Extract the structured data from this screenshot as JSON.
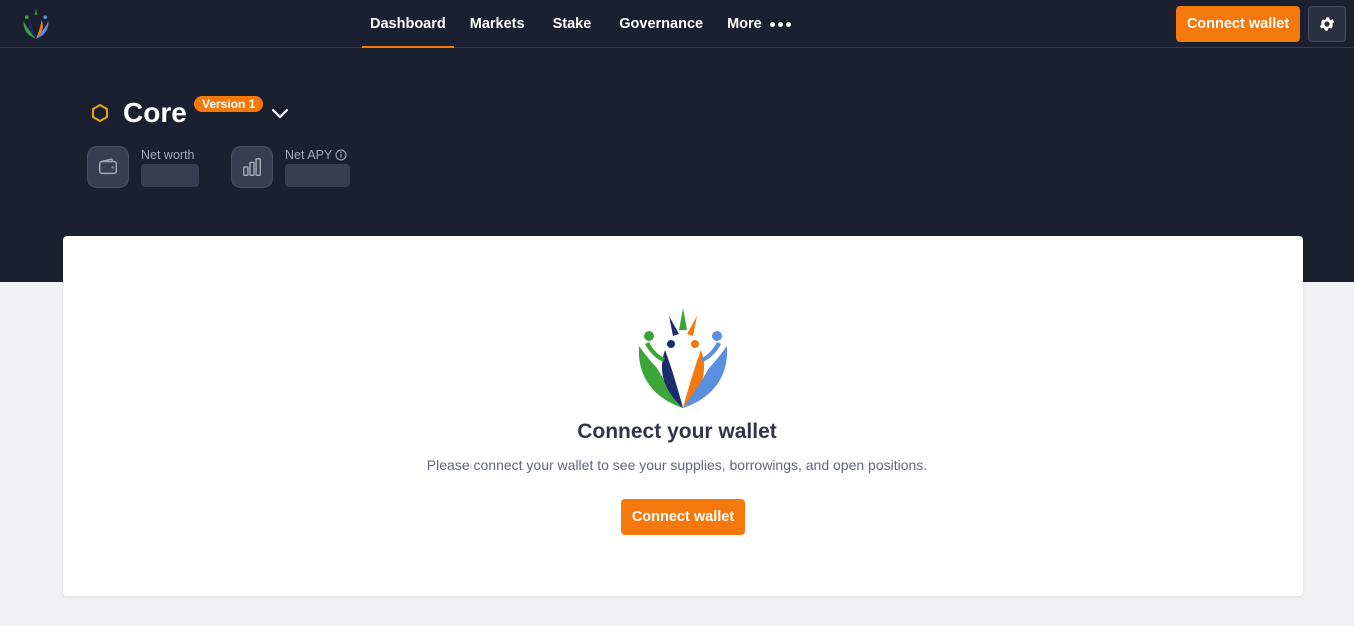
{
  "nav": {
    "items": [
      {
        "label": "Dashboard",
        "active": true
      },
      {
        "label": "Markets",
        "active": false
      },
      {
        "label": "Stake",
        "active": false
      },
      {
        "label": "Governance",
        "active": false
      },
      {
        "label": "More",
        "active": false
      }
    ]
  },
  "header": {
    "connect_label": "Connect wallet",
    "settings_icon": "gear-icon"
  },
  "market": {
    "name": "Core",
    "version": "Version 1",
    "icon": "hexagon-icon"
  },
  "stats": {
    "net_worth_label": "Net worth",
    "net_apy_label": "Net APY",
    "net_worth_icon": "wallet-icon",
    "net_apy_icon": "bar-chart-icon"
  },
  "card": {
    "title": "Connect your wallet",
    "description": "Please connect your wallet to see your supplies, borrowings, and open positions.",
    "button_label": "Connect wallet"
  },
  "colors": {
    "accent": "#f5780c",
    "header_bg": "#1b2030",
    "page_bg": "#f1f1f3"
  }
}
